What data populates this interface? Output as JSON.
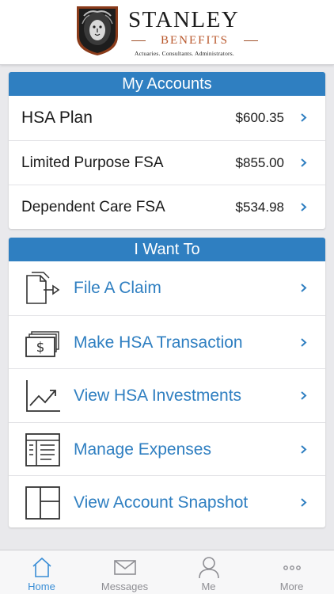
{
  "brand": {
    "name": "STANLEY",
    "subtitle": "BENEFITS",
    "tagline": "Actuaries. Consultants. Administrators."
  },
  "colors": {
    "accent": "#2f7fc1",
    "link": "#2f7fc1",
    "brand_orange": "#b8562a"
  },
  "accounts": {
    "title": "My Accounts",
    "items": [
      {
        "name": "HSA Plan",
        "amount": "$600.35"
      },
      {
        "name": "Limited Purpose FSA",
        "amount": "$855.00"
      },
      {
        "name": "Dependent Care FSA",
        "amount": "$534.98"
      }
    ]
  },
  "want": {
    "title": "I Want To",
    "items": [
      {
        "label": "File A Claim",
        "icon": "file-claim-icon"
      },
      {
        "label": "Make HSA Transaction",
        "icon": "money-icon"
      },
      {
        "label": "View HSA Investments",
        "icon": "chart-icon"
      },
      {
        "label": "Manage Expenses",
        "icon": "expenses-icon"
      },
      {
        "label": "View Account Snapshot",
        "icon": "snapshot-icon"
      }
    ]
  },
  "tabs": [
    {
      "label": "Home",
      "icon": "home-icon",
      "active": true
    },
    {
      "label": "Messages",
      "icon": "mail-icon",
      "active": false
    },
    {
      "label": "Me",
      "icon": "person-icon",
      "active": false
    },
    {
      "label": "More",
      "icon": "more-icon",
      "active": false
    }
  ]
}
